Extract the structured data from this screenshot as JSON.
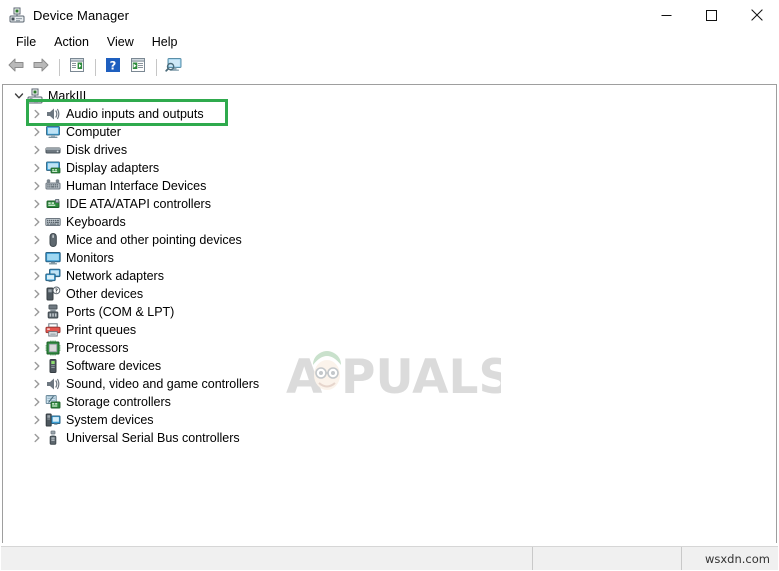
{
  "window": {
    "title": "Device Manager",
    "icon": "device-manager-icon",
    "controls": {
      "minimize": "minimize-icon",
      "maximize": "maximize-icon",
      "close": "close-icon"
    }
  },
  "menubar": {
    "items": [
      {
        "label": "File"
      },
      {
        "label": "Action"
      },
      {
        "label": "View"
      },
      {
        "label": "Help"
      }
    ]
  },
  "toolbar": {
    "buttons": [
      {
        "name": "back-icon"
      },
      {
        "name": "forward-icon"
      },
      {
        "name": "properties-icon"
      },
      {
        "name": "help-icon"
      },
      {
        "name": "update-driver-icon"
      },
      {
        "name": "scan-hardware-changes-icon"
      }
    ]
  },
  "tree": {
    "root": {
      "label": "MarkIII",
      "expanded": true,
      "icon": "computer-icon"
    },
    "items": [
      {
        "label": "Audio inputs and outputs",
        "icon": "speaker-icon",
        "highlighted": true
      },
      {
        "label": "Computer",
        "icon": "computer-icon",
        "highlighted": false
      },
      {
        "label": "Disk drives",
        "icon": "disk-drive-icon",
        "highlighted": false
      },
      {
        "label": "Display adapters",
        "icon": "display-adapter-icon",
        "highlighted": false
      },
      {
        "label": "Human Interface Devices",
        "icon": "hid-icon",
        "highlighted": false
      },
      {
        "label": "IDE ATA/ATAPI controllers",
        "icon": "ide-controller-icon",
        "highlighted": false
      },
      {
        "label": "Keyboards",
        "icon": "keyboard-icon",
        "highlighted": false
      },
      {
        "label": "Mice and other pointing devices",
        "icon": "mouse-icon",
        "highlighted": false
      },
      {
        "label": "Monitors",
        "icon": "monitor-icon",
        "highlighted": false
      },
      {
        "label": "Network adapters",
        "icon": "network-adapter-icon",
        "highlighted": false
      },
      {
        "label": "Other devices",
        "icon": "unknown-device-icon",
        "highlighted": false
      },
      {
        "label": "Ports (COM & LPT)",
        "icon": "port-icon",
        "highlighted": false
      },
      {
        "label": "Print queues",
        "icon": "printer-icon",
        "highlighted": false
      },
      {
        "label": "Processors",
        "icon": "processor-icon",
        "highlighted": false
      },
      {
        "label": "Software devices",
        "icon": "software-device-icon",
        "highlighted": false
      },
      {
        "label": "Sound, video and game controllers",
        "icon": "speaker-icon",
        "highlighted": false
      },
      {
        "label": "Storage controllers",
        "icon": "storage-controller-icon",
        "highlighted": false
      },
      {
        "label": "System devices",
        "icon": "system-device-icon",
        "highlighted": false
      },
      {
        "label": "Universal Serial Bus controllers",
        "icon": "usb-icon",
        "highlighted": false
      }
    ]
  },
  "watermark": {
    "text": "APPUALS",
    "mascot": "appuals-mascot-icon"
  },
  "statusbar": {
    "main": "",
    "mid": "",
    "right": "wsxdn.com"
  },
  "colors": {
    "highlight_green": "#2faa4d",
    "title_text": "#000000",
    "statusbar_bg": "#f0f0f0"
  }
}
